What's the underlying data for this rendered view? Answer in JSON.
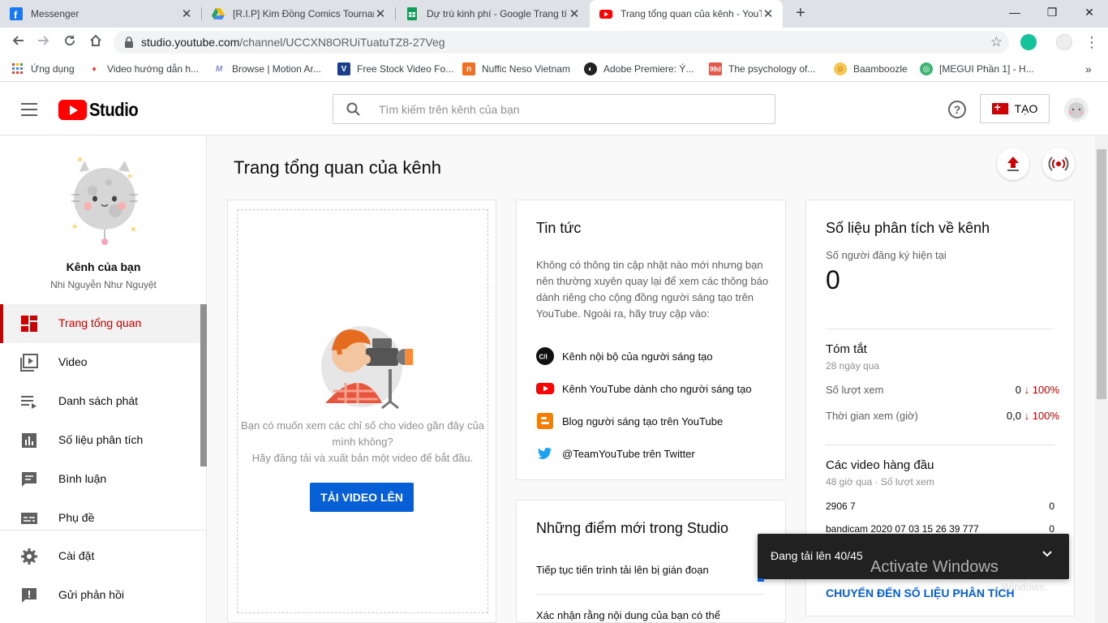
{
  "browser": {
    "tabs": [
      {
        "title": "Messenger",
        "icon": "facebook-icon",
        "color": "#1877f2"
      },
      {
        "title": "[R.I.P] Kim Đồng Comics Tournam",
        "icon": "google-drive-icon",
        "color": "#1fa463"
      },
      {
        "title": "Dự trù kinh phí - Google Trang tí",
        "icon": "google-sheets-icon",
        "color": "#0f9d58"
      },
      {
        "title": "Trang tổng quan của kênh - YouT",
        "icon": "youtube-icon",
        "color": "#ff0000"
      }
    ],
    "close_glyph": "✕",
    "new_tab_glyph": "+",
    "window_controls": {
      "minimize": "—",
      "maximize": "❐",
      "close": "✕"
    },
    "url_host": "studio.youtube.com",
    "url_path": "/channel/UCCXN8ORUiTuatuTZ8-27Veg",
    "bookmarks": [
      {
        "label": "Ứng dụng",
        "icon": "apps-grid-icon"
      },
      {
        "label": "Video hướng dẫn h...",
        "icon": "bookmark-icon"
      },
      {
        "label": "Browse | Motion Ar...",
        "icon": "motion-array-icon"
      },
      {
        "label": "Free Stock Video Fo...",
        "icon": "videvo-icon"
      },
      {
        "label": "Nuffic Neso Vietnam",
        "icon": "nuffic-icon"
      },
      {
        "label": "Adobe Premiere: Ý...",
        "icon": "adobe-icon"
      },
      {
        "label": "The psychology of...",
        "icon": "99designs-icon"
      },
      {
        "label": "Baamboozle",
        "icon": "baamboozle-icon"
      },
      {
        "label": "[MEGUI Phần 1] - H...",
        "icon": "megui-icon"
      }
    ],
    "bookmark_more": "»"
  },
  "header": {
    "logo_text": "Studio",
    "search_placeholder": "Tìm kiếm trên kênh của bạn",
    "help_glyph": "?",
    "create_label": "TẠO"
  },
  "sidebar": {
    "channel_label": "Kênh của bạn",
    "channel_name": "Nhi Nguyễn Như Nguyệt",
    "items": [
      {
        "label": "Trang tổng quan",
        "icon": "dashboard-icon"
      },
      {
        "label": "Video",
        "icon": "video-library-icon"
      },
      {
        "label": "Danh sách phát",
        "icon": "playlist-icon"
      },
      {
        "label": "Số liệu phân tích",
        "icon": "analytics-icon"
      },
      {
        "label": "Bình luận",
        "icon": "comments-icon"
      },
      {
        "label": "Phụ đề",
        "icon": "subtitles-icon"
      },
      {
        "label": "Cài đặt",
        "icon": "settings-icon"
      },
      {
        "label": "Gửi phản hồi",
        "icon": "feedback-icon"
      }
    ]
  },
  "main": {
    "title": "Trang tổng quan của kênh",
    "upload_card": {
      "prompt_line1": "Bạn có muốn xem các chỉ số cho video gần đây của",
      "prompt_line2": "mình không?",
      "prompt_line3": "Hãy đăng tải và xuất bản một video để bắt đầu.",
      "button": "TẢI VIDEO LÊN"
    },
    "news": {
      "title": "Tin tức",
      "body": "Không có thông tin cập nhật nào mới nhưng bạn nên thường xuyên quay lại để xem các thông báo dành riêng cho cộng đồng người sáng tạo trên YouTube. Ngoài ra, hãy truy cập vào:",
      "links": [
        {
          "label": "Kênh nội bộ của người sáng tạo",
          "icon": "creator-insider-icon",
          "badge": "C/I"
        },
        {
          "label": "Kênh YouTube dành cho người sáng tạo",
          "icon": "youtube-icon"
        },
        {
          "label": "Blog người sáng tạo trên YouTube",
          "icon": "blogger-icon"
        },
        {
          "label": "@TeamYouTube trên Twitter",
          "icon": "twitter-icon"
        }
      ]
    },
    "whats_new": {
      "title": "Những điểm mới trong Studio",
      "items": [
        "Tiếp tục tiến trình tải lên bị gián đoạn",
        "Xác nhận rằng nội dung của bạn có thể"
      ]
    },
    "analytics": {
      "title": "Số liệu phân tích về kênh",
      "subs_label": "Số người đăng ký hiện tại",
      "subs_value": "0",
      "summary_title": "Tóm tắt",
      "summary_period": "28 ngày qua",
      "rows": [
        {
          "label": "Số lượt xem",
          "value": "0",
          "change": "100%"
        },
        {
          "label": "Thời gian xem (giờ)",
          "value": "0,0",
          "change": "100%"
        }
      ],
      "down_arrow": "↓",
      "top_videos_title": "Các video hàng đầu",
      "top_videos_period": "48 giờ qua · Số lượt xem",
      "videos": [
        {
          "title": "2906 7",
          "views": "0"
        },
        {
          "title": "bandicam 2020 07 03 15 26 39 777",
          "views": "0"
        }
      ],
      "link": "CHUYỂN ĐẾN SỐ LIỆU PHÂN TÍCH"
    }
  },
  "toast": {
    "text": "Đang tải lên 40/45",
    "progress": 0.02
  },
  "overlay": {
    "watermark": "Activate Windows",
    "watermark_sub": "Windows."
  }
}
